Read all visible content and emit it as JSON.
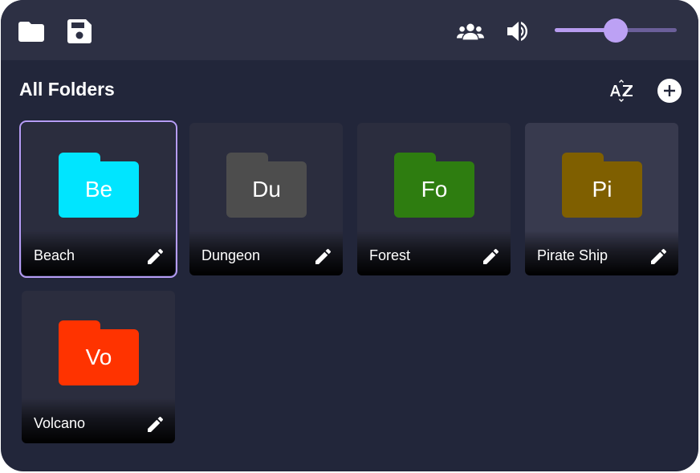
{
  "toolbar": {
    "left_icons": [
      "folder-icon",
      "save-icon"
    ],
    "right_icons": [
      "group-icon",
      "volume-icon"
    ],
    "volume_level": 0.5
  },
  "section": {
    "title": "All Folders",
    "sort_icon": "sort-az-icon",
    "add_icon": "add-circle-icon"
  },
  "folders": [
    {
      "name": "Beach",
      "abbr": "Be",
      "color": "#00e5ff",
      "selected": true
    },
    {
      "name": "Dungeon",
      "abbr": "Du",
      "color": "#4d4d4d"
    },
    {
      "name": "Forest",
      "abbr": "Fo",
      "color": "#2e7d10"
    },
    {
      "name": "Pirate Ship",
      "abbr": "Pi",
      "color": "#7f5f00",
      "hover": true
    },
    {
      "name": "Volcano",
      "abbr": "Vo",
      "color": "#ff3300"
    }
  ],
  "colors": {
    "accent": "#b69cf4",
    "background": "#22263a",
    "topbar": "#2d3044",
    "card": "#2b2d3e"
  }
}
